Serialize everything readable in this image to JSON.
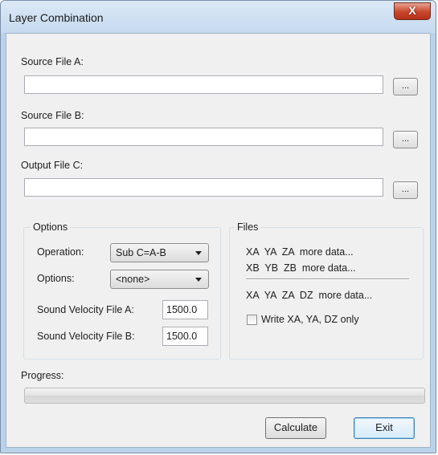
{
  "window": {
    "title": "Layer Combination",
    "close_glyph": "X"
  },
  "source_a": {
    "label": "Source File A:",
    "value": "",
    "browse_label": "..."
  },
  "source_b": {
    "label": "Source File B:",
    "value": "",
    "browse_label": "..."
  },
  "output_c": {
    "label": "Output File C:",
    "value": "",
    "browse_label": "..."
  },
  "options": {
    "group_title": "Options",
    "operation_label": "Operation:",
    "operation_value": "Sub C=A-B",
    "options_label": "Options:",
    "options_value": "<none>",
    "sv_a_label": "Sound Velocity File A:",
    "sv_a_value": "1500.0",
    "sv_b_label": "Sound Velocity File B:",
    "sv_b_value": "1500.0"
  },
  "files": {
    "group_title": "Files",
    "line_a": "XA  YA  ZA  more data...",
    "line_b": "XB  YB  ZB  more data...",
    "line_c": "XA  YA  ZA  DZ  more data...",
    "checkbox_label": "Write XA, YA, DZ only",
    "checkbox_checked": false
  },
  "progress": {
    "label": "Progress:",
    "value": 0
  },
  "buttons": {
    "calculate": "Calculate",
    "exit": "Exit"
  },
  "colors": {
    "frame": "#bcd2ea",
    "close_button": "#c8462b",
    "client_background": "#f0f0f0",
    "default_button_border": "#3c7fb1"
  }
}
